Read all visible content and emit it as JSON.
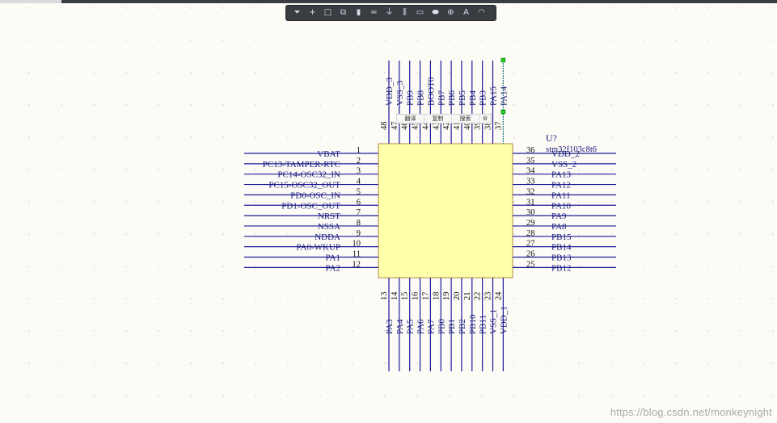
{
  "toolbar": {
    "buttons": [
      {
        "icon": "filter-icon",
        "glyph": "⏷"
      },
      {
        "icon": "move-icon",
        "glyph": "+"
      },
      {
        "icon": "select-rect-icon",
        "glyph": "□"
      },
      {
        "icon": "align-icon",
        "glyph": "⧉"
      },
      {
        "icon": "component-icon",
        "glyph": "▮"
      },
      {
        "icon": "wire-icon",
        "glyph": "≈"
      },
      {
        "icon": "power-port-icon",
        "glyph": "⏚"
      },
      {
        "icon": "bus-icon",
        "glyph": "⫼"
      },
      {
        "icon": "net-label-icon",
        "glyph": "▭"
      },
      {
        "icon": "port-icon",
        "glyph": "⬬"
      },
      {
        "icon": "no-erc-icon",
        "glyph": "⊕"
      },
      {
        "icon": "text-icon",
        "glyph": "A"
      },
      {
        "icon": "arc-icon",
        "glyph": "◠"
      }
    ]
  },
  "component": {
    "designator": "U?",
    "part": "stm32f103c8t6",
    "body_color": "#ffffaa",
    "border_color": "#b08a4a",
    "wire_color": "#1b1b9a",
    "left_pins": [
      {
        "num": "1",
        "name": "VBAT"
      },
      {
        "num": "2",
        "name": "PC13-TAMPER-RTC"
      },
      {
        "num": "3",
        "name": "PC14-OSC32_IN"
      },
      {
        "num": "4",
        "name": "PC15-OSC32_OUT"
      },
      {
        "num": "5",
        "name": "PD0-OSC_IN"
      },
      {
        "num": "6",
        "name": "PD1-OSC_OUT"
      },
      {
        "num": "7",
        "name": "NRST"
      },
      {
        "num": "8",
        "name": "NSSA"
      },
      {
        "num": "9",
        "name": "NDDA"
      },
      {
        "num": "10",
        "name": "PA0-WKUP"
      },
      {
        "num": "11",
        "name": "PA1"
      },
      {
        "num": "12",
        "name": "PA2"
      }
    ],
    "right_pins": [
      {
        "num": "36",
        "name": "VDD_2"
      },
      {
        "num": "35",
        "name": "VSS_2"
      },
      {
        "num": "34",
        "name": "PA13"
      },
      {
        "num": "33",
        "name": "PA12"
      },
      {
        "num": "32",
        "name": "PA11"
      },
      {
        "num": "31",
        "name": "PA10"
      },
      {
        "num": "30",
        "name": "PA9"
      },
      {
        "num": "29",
        "name": "PA8"
      },
      {
        "num": "28",
        "name": "PB15"
      },
      {
        "num": "27",
        "name": "PB14"
      },
      {
        "num": "26",
        "name": "PB13"
      },
      {
        "num": "25",
        "name": "PB12"
      }
    ],
    "top_pins": [
      {
        "num": "48",
        "name": "VDD_3"
      },
      {
        "num": "47",
        "name": "VSS_3"
      },
      {
        "num": "46",
        "name": "PB9"
      },
      {
        "num": "45",
        "name": "PB8"
      },
      {
        "num": "44",
        "name": "BOOT0"
      },
      {
        "num": "43",
        "name": "PB7"
      },
      {
        "num": "42",
        "name": "PB6"
      },
      {
        "num": "41",
        "name": "PB5"
      },
      {
        "num": "40",
        "name": "PB4"
      },
      {
        "num": "39",
        "name": "PB3"
      },
      {
        "num": "38",
        "name": "PA15"
      },
      {
        "num": "37",
        "name": "PA14"
      }
    ],
    "bottom_pins": [
      {
        "num": "13",
        "name": "PA3"
      },
      {
        "num": "14",
        "name": "PA4"
      },
      {
        "num": "15",
        "name": "PA5"
      },
      {
        "num": "16",
        "name": "PA6"
      },
      {
        "num": "17",
        "name": "PA7"
      },
      {
        "num": "18",
        "name": "PB0"
      },
      {
        "num": "19",
        "name": "PB1"
      },
      {
        "num": "20",
        "name": "PB2"
      },
      {
        "num": "21",
        "name": "PB10"
      },
      {
        "num": "22",
        "name": "PB11"
      },
      {
        "num": "23",
        "name": "VSS_1"
      },
      {
        "num": "24",
        "name": "VDD_1"
      }
    ],
    "selected_pin": "37"
  },
  "context_menu": [
    "翻译",
    "复制",
    "搜索",
    "⚙"
  ],
  "watermark": "https://blog.csdn.net/monkeynight"
}
